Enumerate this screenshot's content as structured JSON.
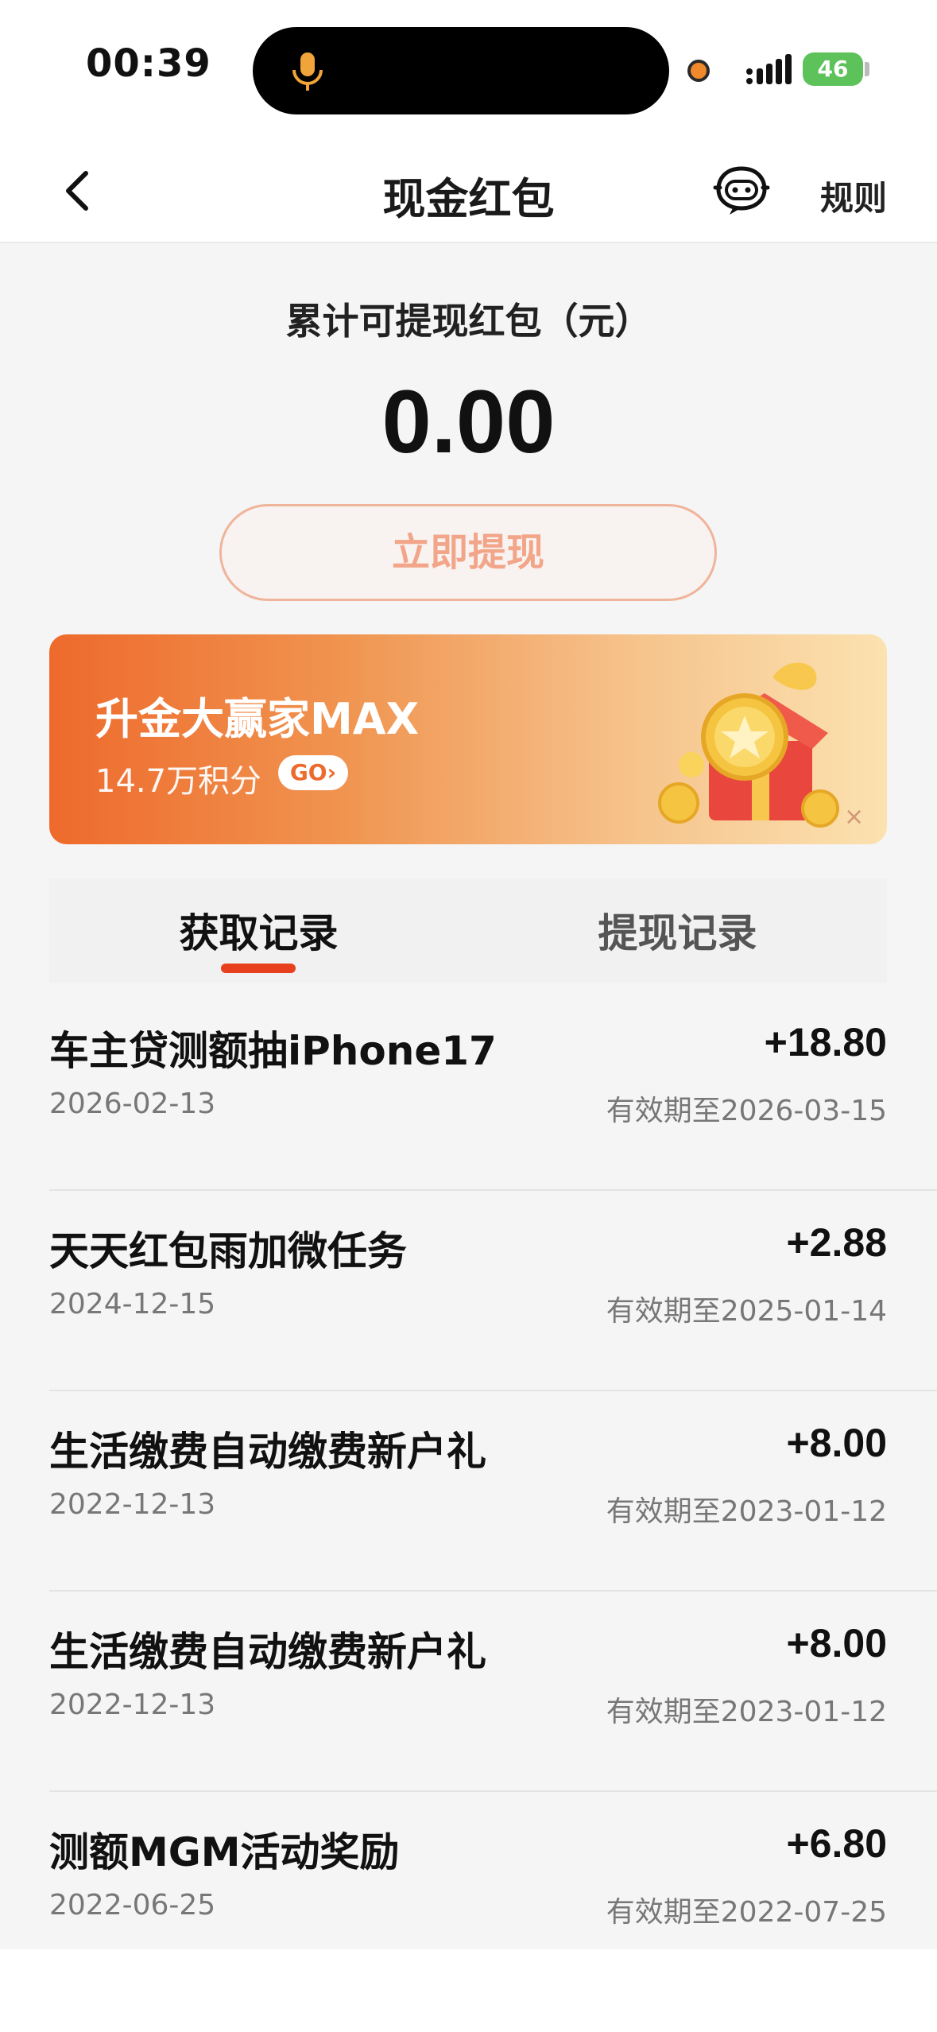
{
  "status_bar": {
    "time": "00:39",
    "battery": "46"
  },
  "nav": {
    "title": "现金红包",
    "rules": "规则"
  },
  "summary": {
    "label": "累计可提现红包（元）",
    "amount": "0.00",
    "withdraw_button": "立即提现"
  },
  "banner": {
    "title": "升金大赢家MAX",
    "subtitle": "14.7万积分",
    "go": "GO›",
    "close": "×"
  },
  "tabs": [
    {
      "label": "获取记录",
      "active": true
    },
    {
      "label": "提现记录",
      "active": false
    }
  ],
  "records": [
    {
      "title": "车主贷测额抽iPhone17",
      "date": "2026-02-13",
      "amount": "+18.80",
      "expiry": "有效期至2026-03-15"
    },
    {
      "title": "天天红包雨加微任务",
      "date": "2024-12-15",
      "amount": "+2.88",
      "expiry": "有效期至2025-01-14"
    },
    {
      "title": "生活缴费自动缴费新户礼",
      "date": "2022-12-13",
      "amount": "+8.00",
      "expiry": "有效期至2023-01-12"
    },
    {
      "title": "生活缴费自动缴费新户礼",
      "date": "2022-12-13",
      "amount": "+8.00",
      "expiry": "有效期至2023-01-12"
    },
    {
      "title": "测额MGM活动奖励",
      "date": "2022-06-25",
      "amount": "+6.80",
      "expiry": "有效期至2022-07-25"
    }
  ],
  "colors": {
    "accent": "#e8401f",
    "banner_start": "#ee6a2c",
    "banner_end": "#fbe2b0",
    "button_border": "#f0b49b"
  },
  "icons": [
    "microphone-icon",
    "signal-icon",
    "battery-icon",
    "back-icon",
    "robot-service-icon",
    "gift-box-icon",
    "close-icon"
  ]
}
